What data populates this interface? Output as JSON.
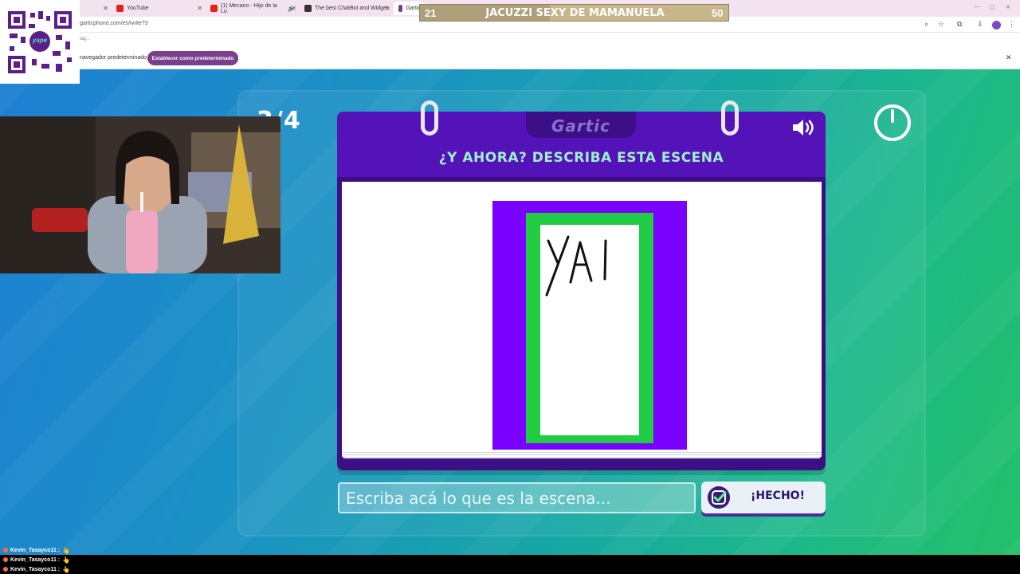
{
  "browser": {
    "tabs": [
      {
        "title": "",
        "active": false
      },
      {
        "title": "YouTube",
        "active": false
      },
      {
        "title": "(1) Mecano - Hijo de la Lu",
        "active": false
      },
      {
        "title": "The best ChatBot and Widget",
        "active": false
      },
      {
        "title": "Gartic",
        "active": true
      }
    ],
    "url": "garticphone.com/es/write?3",
    "bookmark_text": "iag...",
    "infobar_text": "navegador predeterminado",
    "set_default_label": "Establecer como predeterminado"
  },
  "stream": {
    "goal": {
      "current": "21",
      "title": "JACUZZI SEXY DE MAMANUELA",
      "target": "50",
      "progress": 0.42
    },
    "qr_label": "yape"
  },
  "game": {
    "round": "3/4",
    "logo": "Gartic",
    "prompt": "¿Y AHORA? DESCRIBA ESTA ESCENA",
    "drawing_text": "YAI",
    "input_placeholder": "Escriba acá lo que es la escena...",
    "done_label": "¡HECHO!",
    "colors": {
      "card": "#5413b8",
      "frame": "#7a00ff",
      "border": "#22cc44",
      "prompt": "#9ef0c8"
    }
  },
  "chat": [
    {
      "user": "Kevin_Tasayco11 :",
      "emoji": "👆"
    },
    {
      "user": "Kevin_Tasayco11 :",
      "emoji": "👆"
    },
    {
      "user": "Kevin_Tasayco11 :",
      "emoji": "👆"
    }
  ]
}
